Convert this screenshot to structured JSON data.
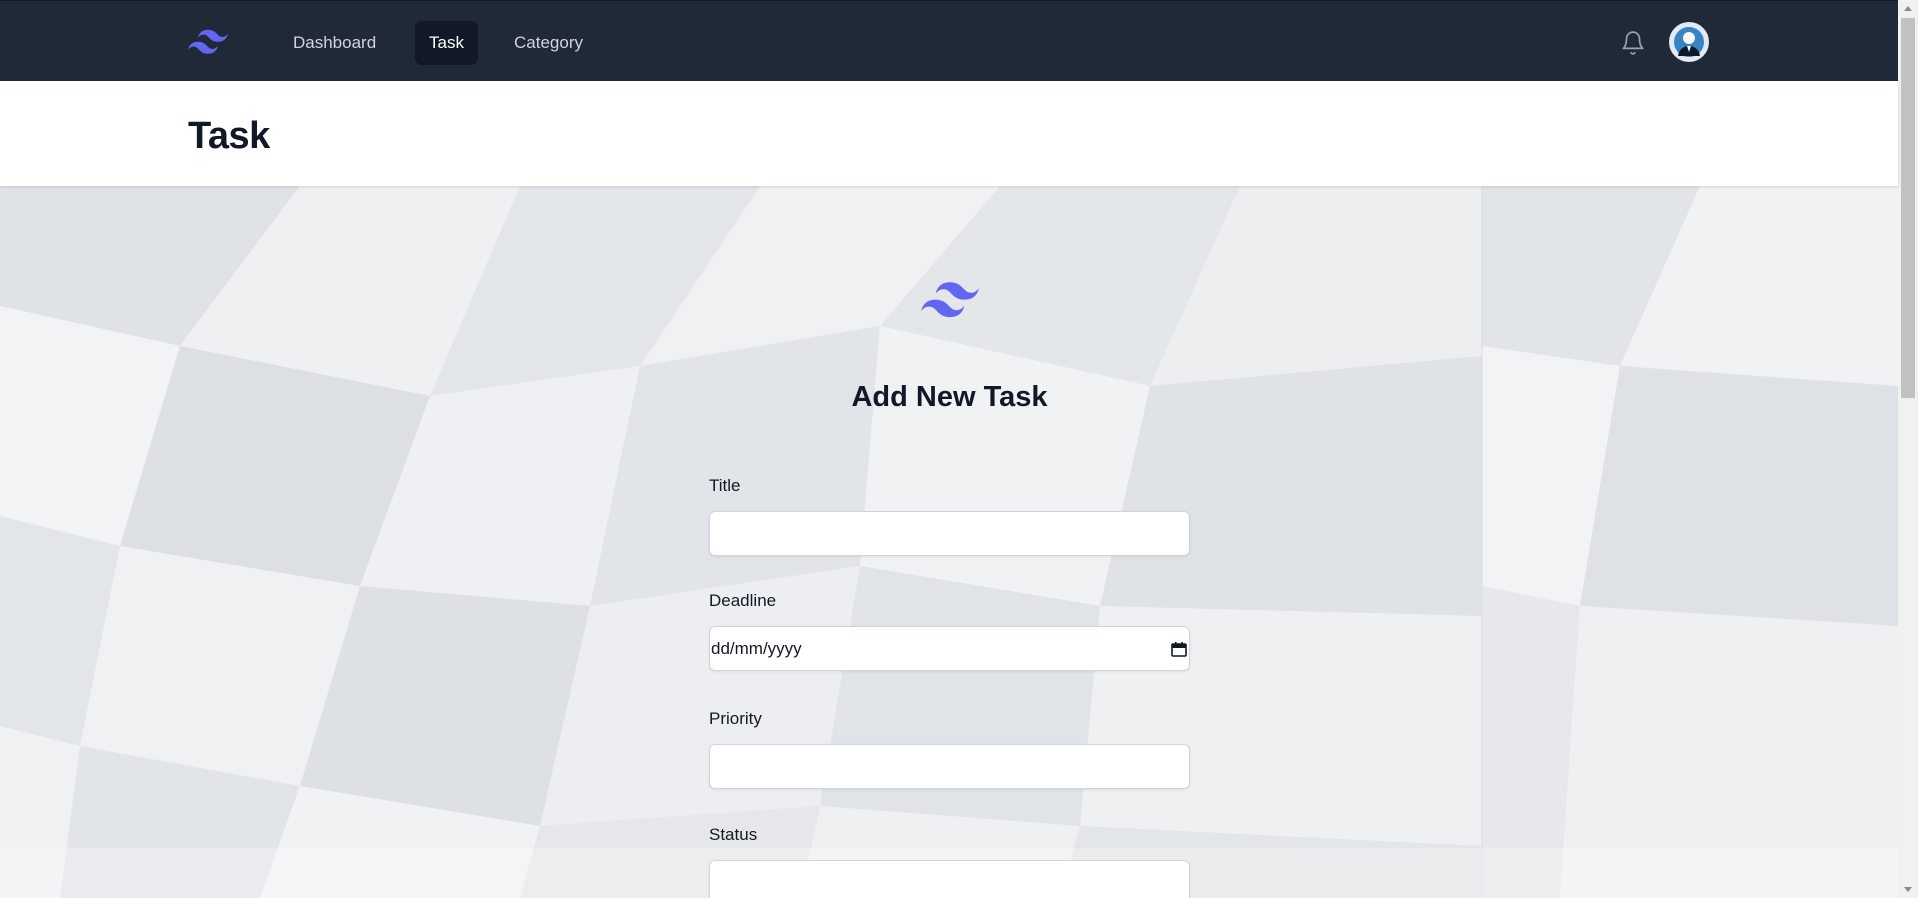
{
  "nav": {
    "logo_icon": "tailwind-logo-icon",
    "links": [
      {
        "label": "Dashboard",
        "active": false
      },
      {
        "label": "Task",
        "active": true
      },
      {
        "label": "Category",
        "active": false
      }
    ],
    "notification_icon": "bell-icon",
    "avatar_icon": "user-avatar"
  },
  "header": {
    "title": "Task"
  },
  "form": {
    "logo_icon": "tailwind-logo-icon",
    "heading": "Add New Task",
    "fields": {
      "title": {
        "label": "Title",
        "value": ""
      },
      "deadline": {
        "label": "Deadline",
        "value": "dd/mm/yyyy"
      },
      "priority": {
        "label": "Priority",
        "value": ""
      },
      "status": {
        "label": "Status",
        "value": ""
      }
    }
  },
  "colors": {
    "nav_bg": "#1f2937",
    "nav_active_bg": "#111827",
    "brand": "#6366f1",
    "heading_text": "#111827"
  }
}
